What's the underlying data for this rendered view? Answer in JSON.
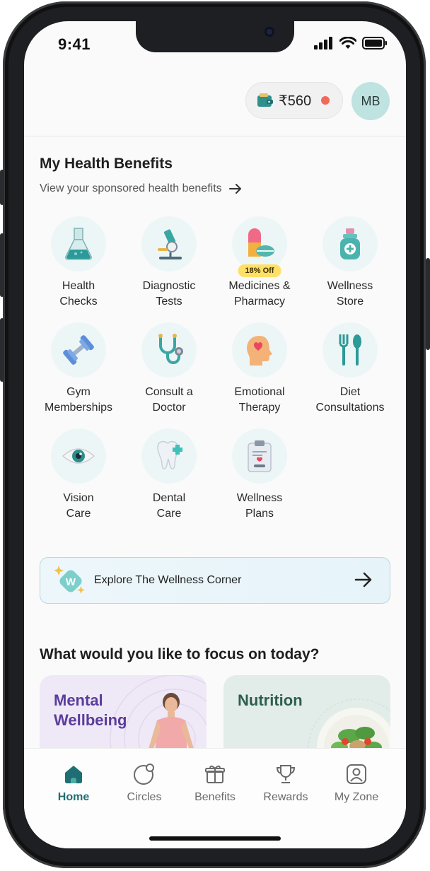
{
  "status_bar": {
    "time": "9:41"
  },
  "header": {
    "wallet_amount": "₹560",
    "avatar_initials": "MB"
  },
  "benefits_section": {
    "title": "My Health Benefits",
    "subtitle": "View your sponsored health benefits",
    "items": [
      {
        "label": "Health\nChecks",
        "icon": "flask-icon"
      },
      {
        "label": "Diagnostic\nTests",
        "icon": "microscope-icon"
      },
      {
        "label": "Medicines &\nPharmacy",
        "icon": "pills-icon",
        "badge": "18% Off"
      },
      {
        "label": "Wellness\nStore",
        "icon": "wellness-bottle-icon"
      },
      {
        "label": "Gym\nMemberships",
        "icon": "dumbbell-icon"
      },
      {
        "label": "Consult a\nDoctor",
        "icon": "stethoscope-icon"
      },
      {
        "label": "Emotional\nTherapy",
        "icon": "head-heart-icon"
      },
      {
        "label": "Diet\nConsultations",
        "icon": "fork-spoon-icon"
      },
      {
        "label": "Vision\nCare",
        "icon": "eye-icon"
      },
      {
        "label": "Dental\nCare",
        "icon": "tooth-icon"
      },
      {
        "label": "Wellness\nPlans",
        "icon": "clipboard-icon"
      }
    ]
  },
  "explore": {
    "label": "Explore The Wellness Corner",
    "logo_letter": "W"
  },
  "focus_section": {
    "title": "What would you like to focus on today?",
    "cards": [
      {
        "label": "Mental\nWellbeing",
        "color": "#5a3d9a"
      },
      {
        "label": "Nutrition",
        "color": "#2e5e4e"
      }
    ]
  },
  "tabbar": {
    "tabs": [
      {
        "label": "Home",
        "icon": "home-icon",
        "active": true
      },
      {
        "label": "Circles",
        "icon": "circles-icon"
      },
      {
        "label": "Benefits",
        "icon": "gift-icon"
      },
      {
        "label": "Rewards",
        "icon": "trophy-icon"
      },
      {
        "label": "My Zone",
        "icon": "profile-icon"
      }
    ]
  },
  "colors": {
    "accent": "#1f6e73",
    "wallet_dot": "#ef6a5a",
    "avatar_bg": "#bfe3e0"
  }
}
